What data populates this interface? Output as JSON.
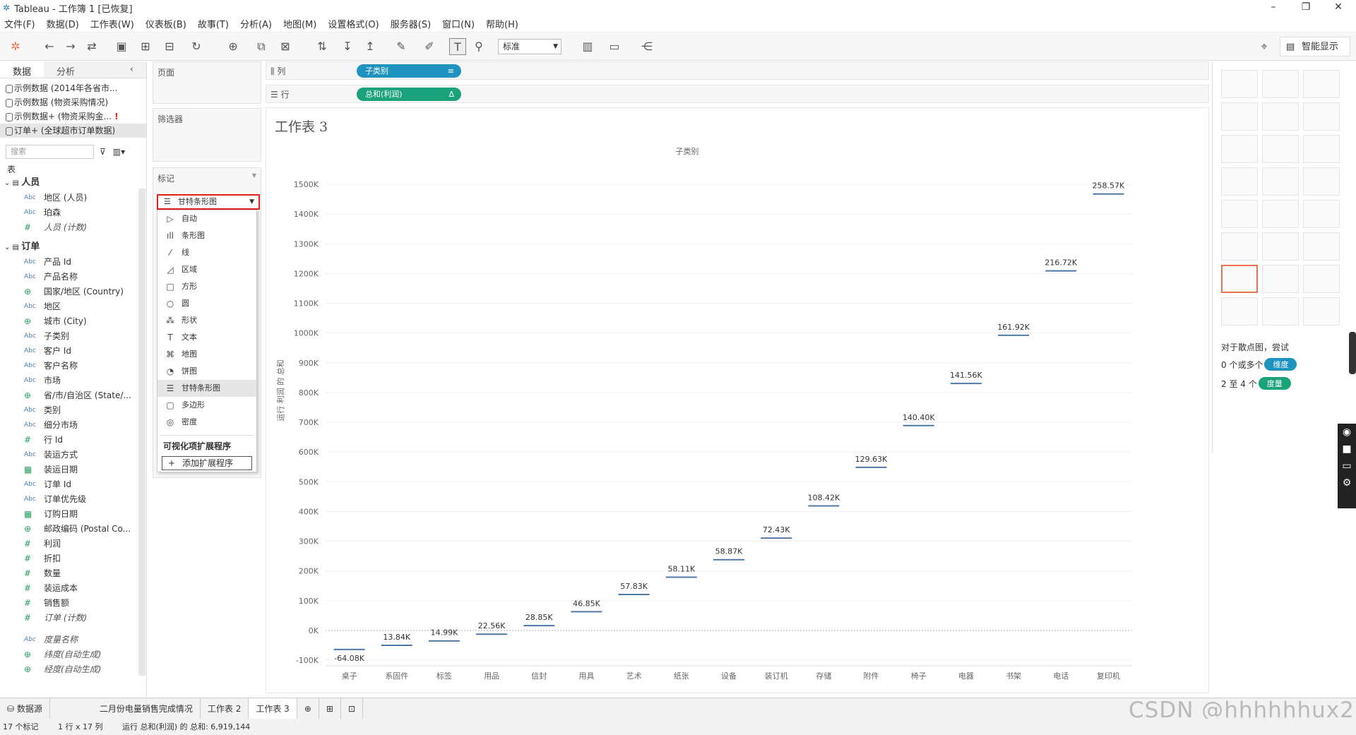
{
  "window": {
    "title": "Tableau - 工作簿 1 [已恢复]",
    "min": "–",
    "max": "❐",
    "close": "✕"
  },
  "menu": [
    "文件(F)",
    "数据(D)",
    "工作表(W)",
    "仪表板(B)",
    "故事(T)",
    "分析(A)",
    "地图(M)",
    "设置格式(O)",
    "服务器(S)",
    "窗口(N)",
    "帮助(H)"
  ],
  "toolbar": {
    "fit": "标准",
    "smart_show": "智能显示"
  },
  "left": {
    "tab_data": "数据",
    "tab_analysis": "分析",
    "datasources": [
      "示例数据 (2014年各省市...",
      "示例数据 (物资采购情况)",
      "示例数据+ (物资采购金...",
      "订单+ (全球超市订单数据)"
    ],
    "search_placeholder": "搜索",
    "tables_label": "表",
    "group1": "人员",
    "group1_fields": [
      {
        "t": "Abc",
        "n": "地区 (人员)"
      },
      {
        "t": "Abc",
        "n": "珀森"
      },
      {
        "t": "#",
        "n": "人员 (计数)"
      }
    ],
    "group2": "订单",
    "group2_fields": [
      {
        "t": "Abc",
        "n": "产品 Id"
      },
      {
        "t": "Abc",
        "n": "产品名称"
      },
      {
        "t": "⊕",
        "n": "国家/地区 (Country)"
      },
      {
        "t": "Abc",
        "n": "地区"
      },
      {
        "t": "⊕",
        "n": "城市 (City)"
      },
      {
        "t": "Abc",
        "n": "子类别"
      },
      {
        "t": "Abc",
        "n": "客户 Id"
      },
      {
        "t": "Abc",
        "n": "客户名称"
      },
      {
        "t": "Abc",
        "n": "市场"
      },
      {
        "t": "⊕",
        "n": "省/市/自治区 (State/..."
      },
      {
        "t": "Abc",
        "n": "类别"
      },
      {
        "t": "Abc",
        "n": "细分市场"
      },
      {
        "t": "#",
        "n": "行 Id"
      },
      {
        "t": "Abc",
        "n": "装运方式"
      },
      {
        "t": "▦",
        "n": "装运日期"
      },
      {
        "t": "Abc",
        "n": "订单 Id"
      },
      {
        "t": "Abc",
        "n": "订单优先级"
      },
      {
        "t": "▦",
        "n": "订购日期"
      },
      {
        "t": "⊕",
        "n": "邮政编码 (Postal Co..."
      },
      {
        "t": "#",
        "n": "利润"
      },
      {
        "t": "#",
        "n": "折扣"
      },
      {
        "t": "#",
        "n": "数量"
      },
      {
        "t": "#",
        "n": "装运成本"
      },
      {
        "t": "#",
        "n": "销售额"
      },
      {
        "t": "#",
        "n": "订单 (计数)"
      }
    ],
    "extra_fields": [
      {
        "t": "Abc",
        "n": "度量名称"
      },
      {
        "t": "⊕",
        "n": "纬度(自动生成)"
      },
      {
        "t": "⊕",
        "n": "经度(自动生成)"
      }
    ]
  },
  "cards": {
    "pages": "页面",
    "filters": "筛选器",
    "marks": "标记"
  },
  "marks": {
    "selected": "甘特条形图",
    "items": [
      {
        "ic": "▷",
        "n": "自动"
      },
      {
        "ic": "ıll",
        "n": "条形图"
      },
      {
        "ic": "⁄",
        "n": "线"
      },
      {
        "ic": "◿",
        "n": "区域"
      },
      {
        "ic": "□",
        "n": "方形"
      },
      {
        "ic": "○",
        "n": "圆"
      },
      {
        "ic": "⁂",
        "n": "形状"
      },
      {
        "ic": "T",
        "n": "文本"
      },
      {
        "ic": "⌘",
        "n": "地图"
      },
      {
        "ic": "◔",
        "n": "饼图"
      },
      {
        "ic": "☰",
        "n": "甘特条形图"
      },
      {
        "ic": "▢",
        "n": "多边形"
      },
      {
        "ic": "◎",
        "n": "密度"
      }
    ],
    "ext_header": "可视化项扩展程序",
    "ext_button": "添加扩展程序"
  },
  "shelves": {
    "cols_label": "列",
    "rows_label": "行",
    "col_pill": "子类别",
    "row_pill": "总和(利润)",
    "row_pill_mark": "Δ"
  },
  "sheet": {
    "title": "工作表 3"
  },
  "chart_data": {
    "type": "gantt",
    "title": "子类别",
    "ylabel": "运行 利润 的 总和",
    "ylim": [
      -100,
      1500
    ],
    "yticks": [
      "-100K",
      "0K",
      "100K",
      "200K",
      "300K",
      "400K",
      "500K",
      "600K",
      "700K",
      "800K",
      "900K",
      "1000K",
      "1100K",
      "1200K",
      "1300K",
      "1400K",
      "1500K"
    ],
    "categories": [
      "桌子",
      "系固件",
      "标签",
      "用品",
      "信封",
      "用具",
      "艺术",
      "纸张",
      "设备",
      "装订机",
      "存储",
      "附件",
      "椅子",
      "电器",
      "书架",
      "电话",
      "复印机"
    ],
    "values": [
      -64.08,
      -50.24,
      -35.25,
      -12.69,
      16.16,
      63.01,
      120.84,
      178.95,
      237.82,
      310.25,
      418.67,
      548.3,
      688.7,
      830.26,
      992.18,
      1208.9,
      1467.47
    ],
    "labels": [
      "-64.08K",
      "13.84K",
      "14.99K",
      "22.56K",
      "28.85K",
      "46.85K",
      "57.83K",
      "58.11K",
      "58.87K",
      "72.43K",
      "108.42K",
      "129.63K",
      "140.40K",
      "141.56K",
      "161.92K",
      "216.72K",
      "258.57K"
    ],
    "color": "#4e79a7"
  },
  "smart": {
    "hint": "对于散点图，尝试",
    "line1": "0 个或多个",
    "line1_pill": "维度",
    "line2": "2 至 4 个",
    "line2_pill": "度量"
  },
  "bottom": {
    "datasource": "数据源",
    "tabs": [
      "二月份电量销售完成情况",
      "工作表 2",
      "工作表 3"
    ]
  },
  "status": {
    "marks": "17 个标记",
    "dims": "1 行 x 17 列",
    "sum": "运行 总和(利润) 的 总和: 6,919,144"
  },
  "watermark": "CSDN @hhhhhhux2"
}
